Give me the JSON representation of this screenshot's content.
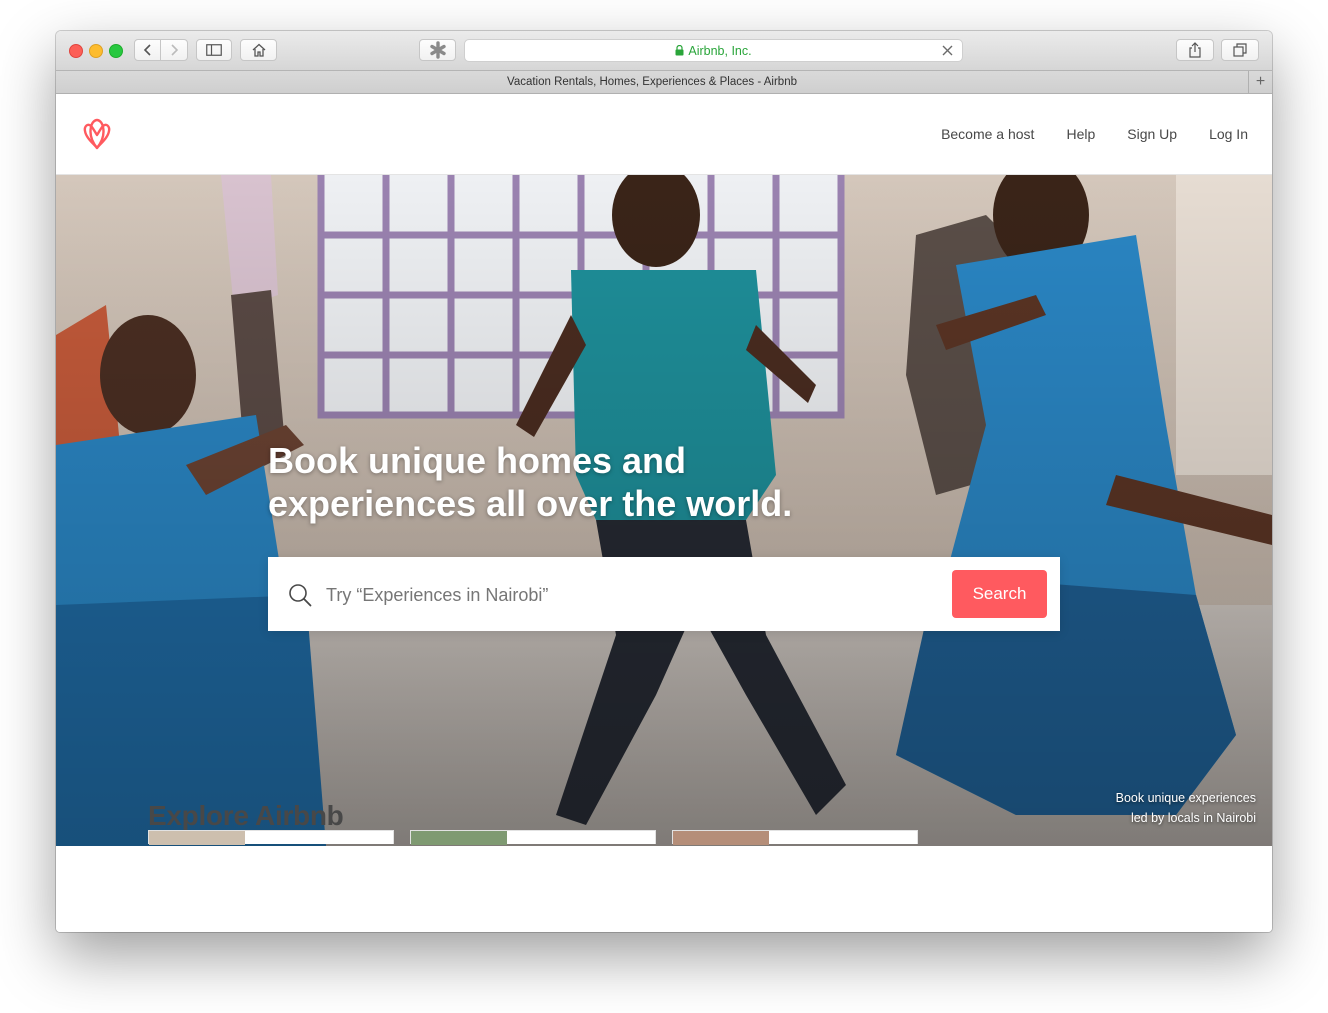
{
  "browser": {
    "url": "Airbnb, Inc.",
    "tab_title": "Vacation Rentals, Homes, Experiences & Places - Airbnb"
  },
  "header": {
    "logo_icon": "airbnb-belo-logo",
    "nav": [
      "Become a host",
      "Help",
      "Sign Up",
      "Log In"
    ]
  },
  "hero": {
    "headline_line1": "Book unique homes and",
    "headline_line2": "experiences all over the world.",
    "search_placeholder": "Try “Experiences in Nairobi”",
    "search_button": "Search",
    "caption_line1": "Book unique experiences",
    "caption_line2": "led by locals in Nairobi"
  },
  "explore": {
    "title": "Explore Airbnb"
  },
  "colors": {
    "brand": "#FF5A5F",
    "url_green": "#2AA53A",
    "text": "#484848"
  }
}
